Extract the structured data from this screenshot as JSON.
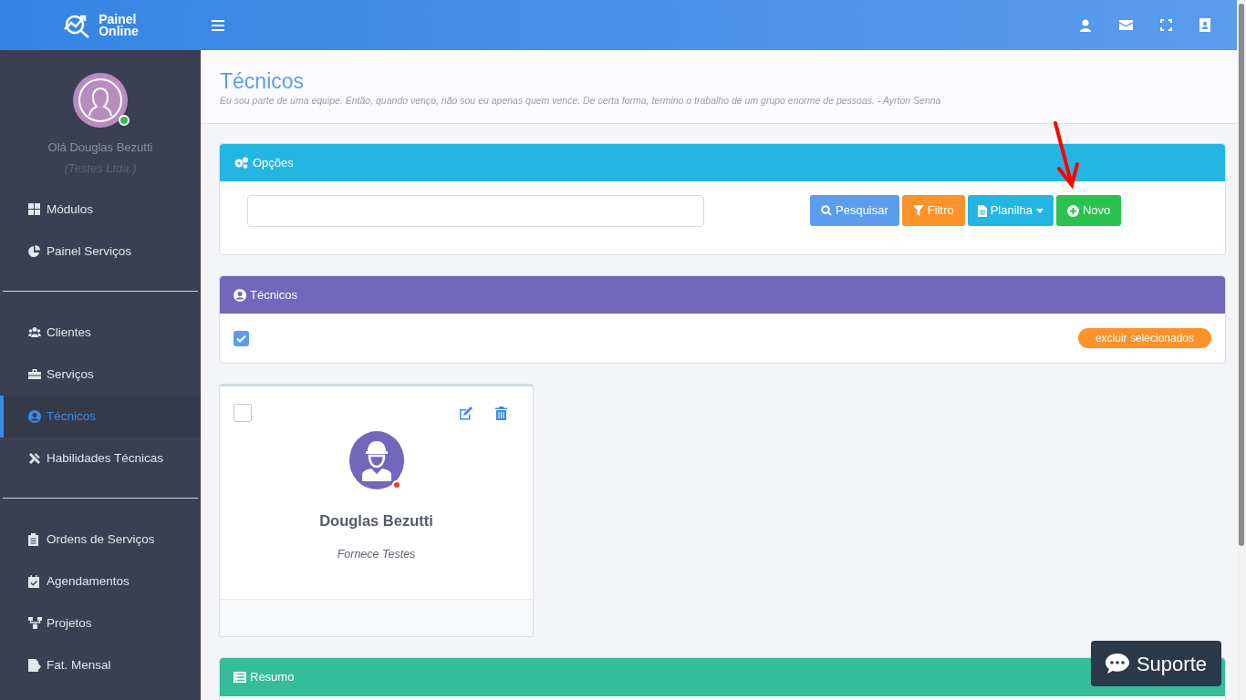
{
  "header": {
    "logo_line1": "Painel",
    "logo_line2": "Online"
  },
  "user": {
    "greeting": "Olá Douglas Bezutti",
    "company": "(Testes Ltda.)",
    "online": true
  },
  "sidebar": {
    "groups": [
      [
        {
          "label": "Módulos",
          "kind": "grid",
          "selected": false
        },
        {
          "label": "Painel Serviços",
          "kind": "pie",
          "selected": false
        }
      ],
      [
        {
          "label": "Clientes",
          "kind": "users",
          "selected": false
        },
        {
          "label": "Serviços",
          "kind": "briefcase",
          "selected": false
        },
        {
          "label": "Técnicos",
          "kind": "user",
          "selected": true
        },
        {
          "label": "Habilidades Técnicas",
          "kind": "tools",
          "selected": false
        }
      ],
      [
        {
          "label": "Ordens de Serviços",
          "kind": "clipboard",
          "selected": false
        },
        {
          "label": "Agendamentos",
          "kind": "calendar",
          "selected": false
        },
        {
          "label": "Projetos",
          "kind": "sitemap",
          "selected": false
        },
        {
          "label": "Fat. Mensal",
          "kind": "file",
          "selected": false
        }
      ]
    ]
  },
  "page": {
    "title": "Técnicos",
    "quote": "Eu sou parte de uma equipe. Então, quando venço, não sou eu apenas quem vence. De certa forma, termino o trabalho de um grupo enorme de pessoas. - Ayrton Senna"
  },
  "options_panel": {
    "title": "Opções",
    "buttons": [
      {
        "label": "Pesquisar",
        "kind": "search"
      },
      {
        "label": "Filtro",
        "kind": "filter"
      },
      {
        "label": "Planilha",
        "kind": "sheet"
      },
      {
        "label": "Novo",
        "kind": "new"
      }
    ]
  },
  "technicians_panel": {
    "title": "Técnicos",
    "select_all": true,
    "delete_button": "excluir selecionados"
  },
  "cards": [
    {
      "name": "Douglas Bezutti",
      "role": "Fornece Testes",
      "checked": false,
      "online": false
    }
  ],
  "summary_panel": {
    "title": "Resumo"
  },
  "support_button": "Suporte"
}
